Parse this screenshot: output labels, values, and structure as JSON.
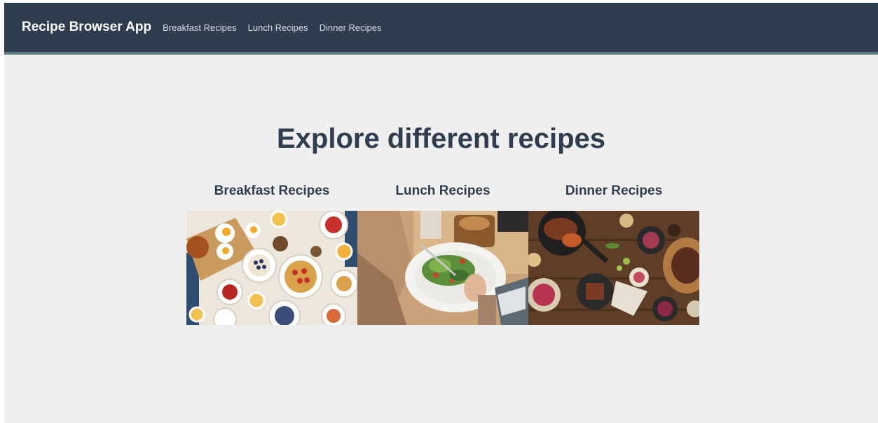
{
  "app": {
    "brand": "Recipe Browser App"
  },
  "nav": {
    "items": [
      {
        "label": "Breakfast Recipes"
      },
      {
        "label": "Lunch Recipes"
      },
      {
        "label": "Dinner Recipes"
      }
    ]
  },
  "main": {
    "headline": "Explore different recipes",
    "cards": [
      {
        "title": "Breakfast Recipes",
        "image": "breakfast-spread-photo"
      },
      {
        "title": "Lunch Recipes",
        "image": "salad-plate-photo"
      },
      {
        "title": "Dinner Recipes",
        "image": "dinner-table-photo"
      }
    ]
  },
  "colors": {
    "navbar": "#2e3d4f",
    "navbar_border": "#5d7a80",
    "page_background": "#efefef",
    "heading_text": "#2e3d4f"
  }
}
